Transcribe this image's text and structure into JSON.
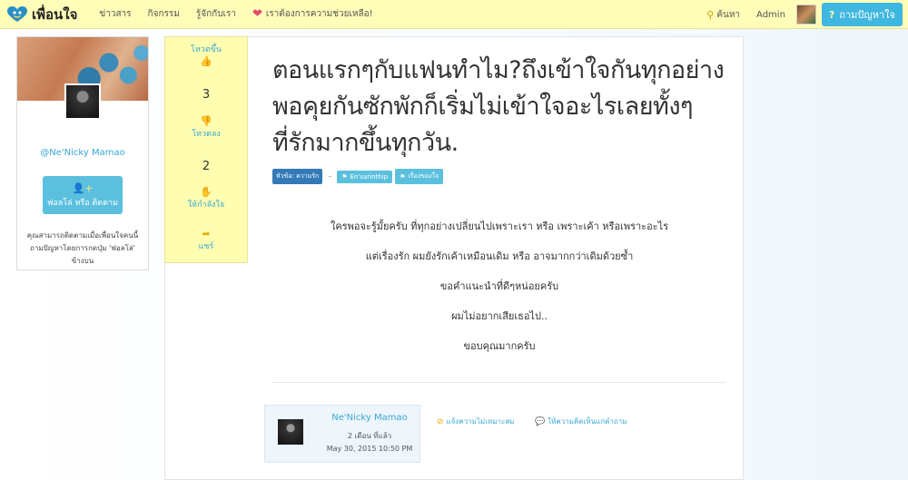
{
  "navbar": {
    "brand": "เพื่อนใจ",
    "links": [
      "ข่าวสาร",
      "กิจกรรม",
      "รู้จักกับเรา"
    ],
    "help_text": "เราต้องการความช่วยเหลือ!",
    "search": "ค้นหา",
    "admin": "Admin",
    "ask_button": "ถามปัญหาใจ",
    "colors": {
      "bar": "#fffdb8",
      "ask_button": "#3fb7e0"
    }
  },
  "profile": {
    "name": "@Ne'Nicky Mamao",
    "follow_button": "ฟอลโล่ หรือ ติดตาม",
    "note": "คุณสามารถติดตามเมื่อเพื่อนใจคนนี้ถามปัญหาโดยการกดปุ่ม 'ฟอลโล่' ข้างบน"
  },
  "votes": {
    "up_label": "โหวตขึ้น",
    "up_count": "3",
    "down_label": "โหวตลง",
    "down_count": "2",
    "encourage_label": "ให้กำลังใจ",
    "share_label": "แชร์"
  },
  "post": {
    "title": "ตอนแรกๆกับแฟนทำไม?ถึงเข้าใจกันทุกอย่าง พอคุยกันซักพักก็เริ่มไม่เข้าใจอะไรเลยทั้งๆที่รักมากขึ้นทุกวัน.",
    "topic": "หัวข้อ: ความรัก",
    "tag_separator": "–",
    "tags": [
      "En'sarinthip",
      "เรื่องของใจ"
    ],
    "body": [
      "ใครพอจะรู้มั้ยครับ ที่ทุกอย่างเปลี่ยนไปเพราะเรา หรือ เพราะเค้า หรือเพราะอะไร",
      "แต่เรื่องรัก ผมยังรักเค้าเหมือนเดิม หรือ อาจมากกว่าเดิมด้วยซ้ำ",
      "ขอคำแนะนำที่ดีๆหน่อยครับ",
      "ผมไม่อยากเสียเธอไป..",
      "ขอบคุณมากครับ"
    ]
  },
  "author": {
    "name": "Ne'Nicky Mamao",
    "relative_time": "2 เดือน ที่แล้ว",
    "date": "May 30, 2015 10:50 PM"
  },
  "actions": {
    "report": "แจ้งความไม่เหมาะสม",
    "comment": "ให้ความคิดเห็นแก่คำถาม"
  }
}
